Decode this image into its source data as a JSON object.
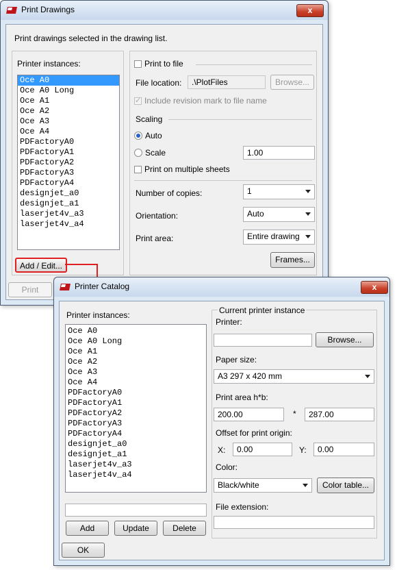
{
  "print_dialog": {
    "title": "Print Drawings",
    "close_label": "x",
    "instruction": "Print drawings selected in the drawing list.",
    "printer_instances_label": "Printer instances:",
    "printers": [
      "Oce A0",
      "Oce A0 Long",
      "Oce A1",
      "Oce A2",
      "Oce A3",
      "Oce A4",
      "PDFactoryA0",
      "PDFactoryA1",
      "PDFactoryA2",
      "PDFactoryA3",
      "PDFactoryA4",
      "designjet_a0",
      "designjet_a1",
      "laserjet4v_a3",
      "laserjet4v_a4"
    ],
    "selected_printer": "Oce A0",
    "add_edit_label": "Add / Edit...",
    "print_label": "Print",
    "print_to_file_label": "Print to file",
    "file_location_label": "File location:",
    "file_location_value": ".\\PlotFiles",
    "browse_label": "Browse...",
    "include_revision_label": "Include revision mark to file name",
    "scaling_label": "Scaling",
    "auto_label": "Auto",
    "scale_label": "Scale",
    "scale_value": "1.00",
    "multiple_sheets_label": "Print on multiple sheets",
    "copies_label": "Number of copies:",
    "copies_value": "1",
    "orientation_label": "Orientation:",
    "orientation_value": "Auto",
    "print_area_label": "Print area:",
    "print_area_value": "Entire drawing",
    "frames_label": "Frames..."
  },
  "catalog_dialog": {
    "title": "Printer Catalog",
    "close_label": "x",
    "printer_instances_label": "Printer instances:",
    "printers": [
      "Oce A0",
      "Oce A0 Long",
      "Oce A1",
      "Oce A2",
      "Oce A3",
      "Oce A4",
      "PDFactoryA0",
      "PDFactoryA1",
      "PDFactoryA2",
      "PDFactoryA3",
      "PDFactoryA4",
      "designjet_a0",
      "designjet_a1",
      "laserjet4v_a3",
      "laserjet4v_a4"
    ],
    "name_value": "",
    "add_label": "Add",
    "update_label": "Update",
    "delete_label": "Delete",
    "ok_label": "OK",
    "current_group_label": "Current printer instance",
    "printer_label": "Printer:",
    "printer_value": "",
    "browse_label": "Browse...",
    "paper_size_label": "Paper size:",
    "paper_size_value": "A3 297 x 420 mm",
    "print_area_label": "Print area h*b:",
    "print_area_h": "200.00",
    "print_area_sep": "*",
    "print_area_b": "287.00",
    "offset_label": "Offset for print origin:",
    "x_label": "X:",
    "x_value": "0.00",
    "y_label": "Y:",
    "y_value": "0.00",
    "color_label": "Color:",
    "color_value": "Black/white",
    "color_table_label": "Color table...",
    "file_extension_label": "File extension:",
    "file_extension_value": ""
  },
  "colors": {
    "accent": "#e02020",
    "selection": "#3399ff"
  }
}
